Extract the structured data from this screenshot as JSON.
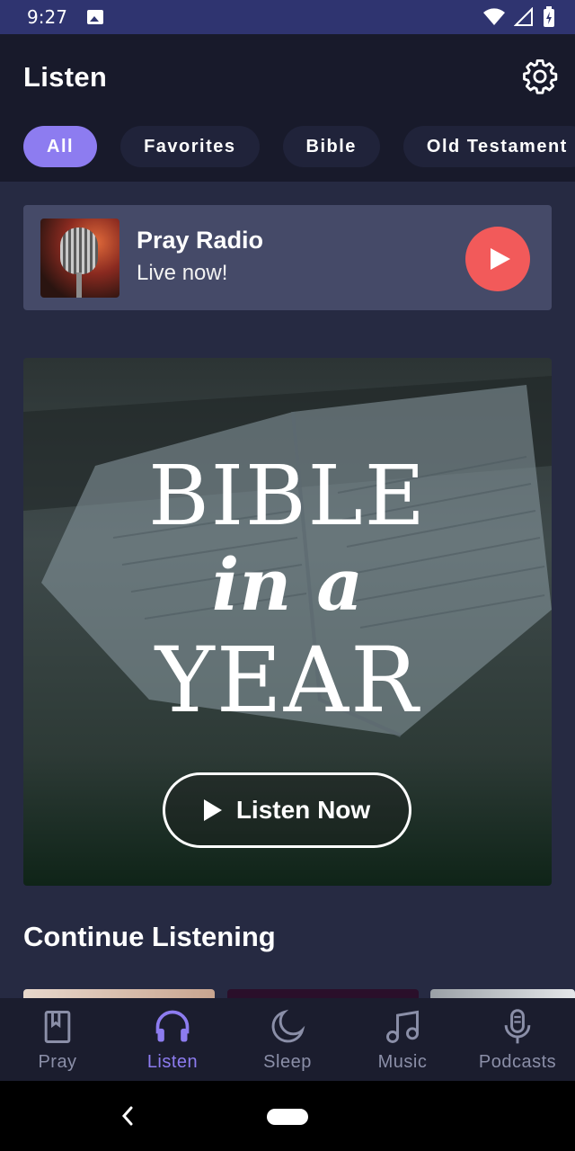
{
  "status_bar": {
    "time": "9:27"
  },
  "header": {
    "title": "Listen",
    "chips": [
      {
        "label": "All",
        "active": true
      },
      {
        "label": "Favorites",
        "active": false
      },
      {
        "label": "Bible",
        "active": false
      },
      {
        "label": "Old Testament",
        "active": false
      }
    ]
  },
  "radio_card": {
    "title": "Pray Radio",
    "subtitle": "Live now!"
  },
  "hero": {
    "line1": "BIBLE",
    "line2": "in a",
    "line3": "YEAR",
    "button_label": "Listen Now"
  },
  "continue_section": {
    "title": "Continue Listening"
  },
  "bottom_nav": {
    "items": [
      {
        "label": "Pray",
        "icon": "bookmark-book-icon"
      },
      {
        "label": "Listen",
        "icon": "headphones-icon"
      },
      {
        "label": "Sleep",
        "icon": "moon-icon"
      },
      {
        "label": "Music",
        "icon": "music-note-icon"
      },
      {
        "label": "Podcasts",
        "icon": "microphone-icon"
      }
    ],
    "active_index": 1
  },
  "colors": {
    "accent": "#8d7cf0",
    "play_red": "#f25a5a",
    "background": "#262a42",
    "header_bg": "#181a2b"
  }
}
